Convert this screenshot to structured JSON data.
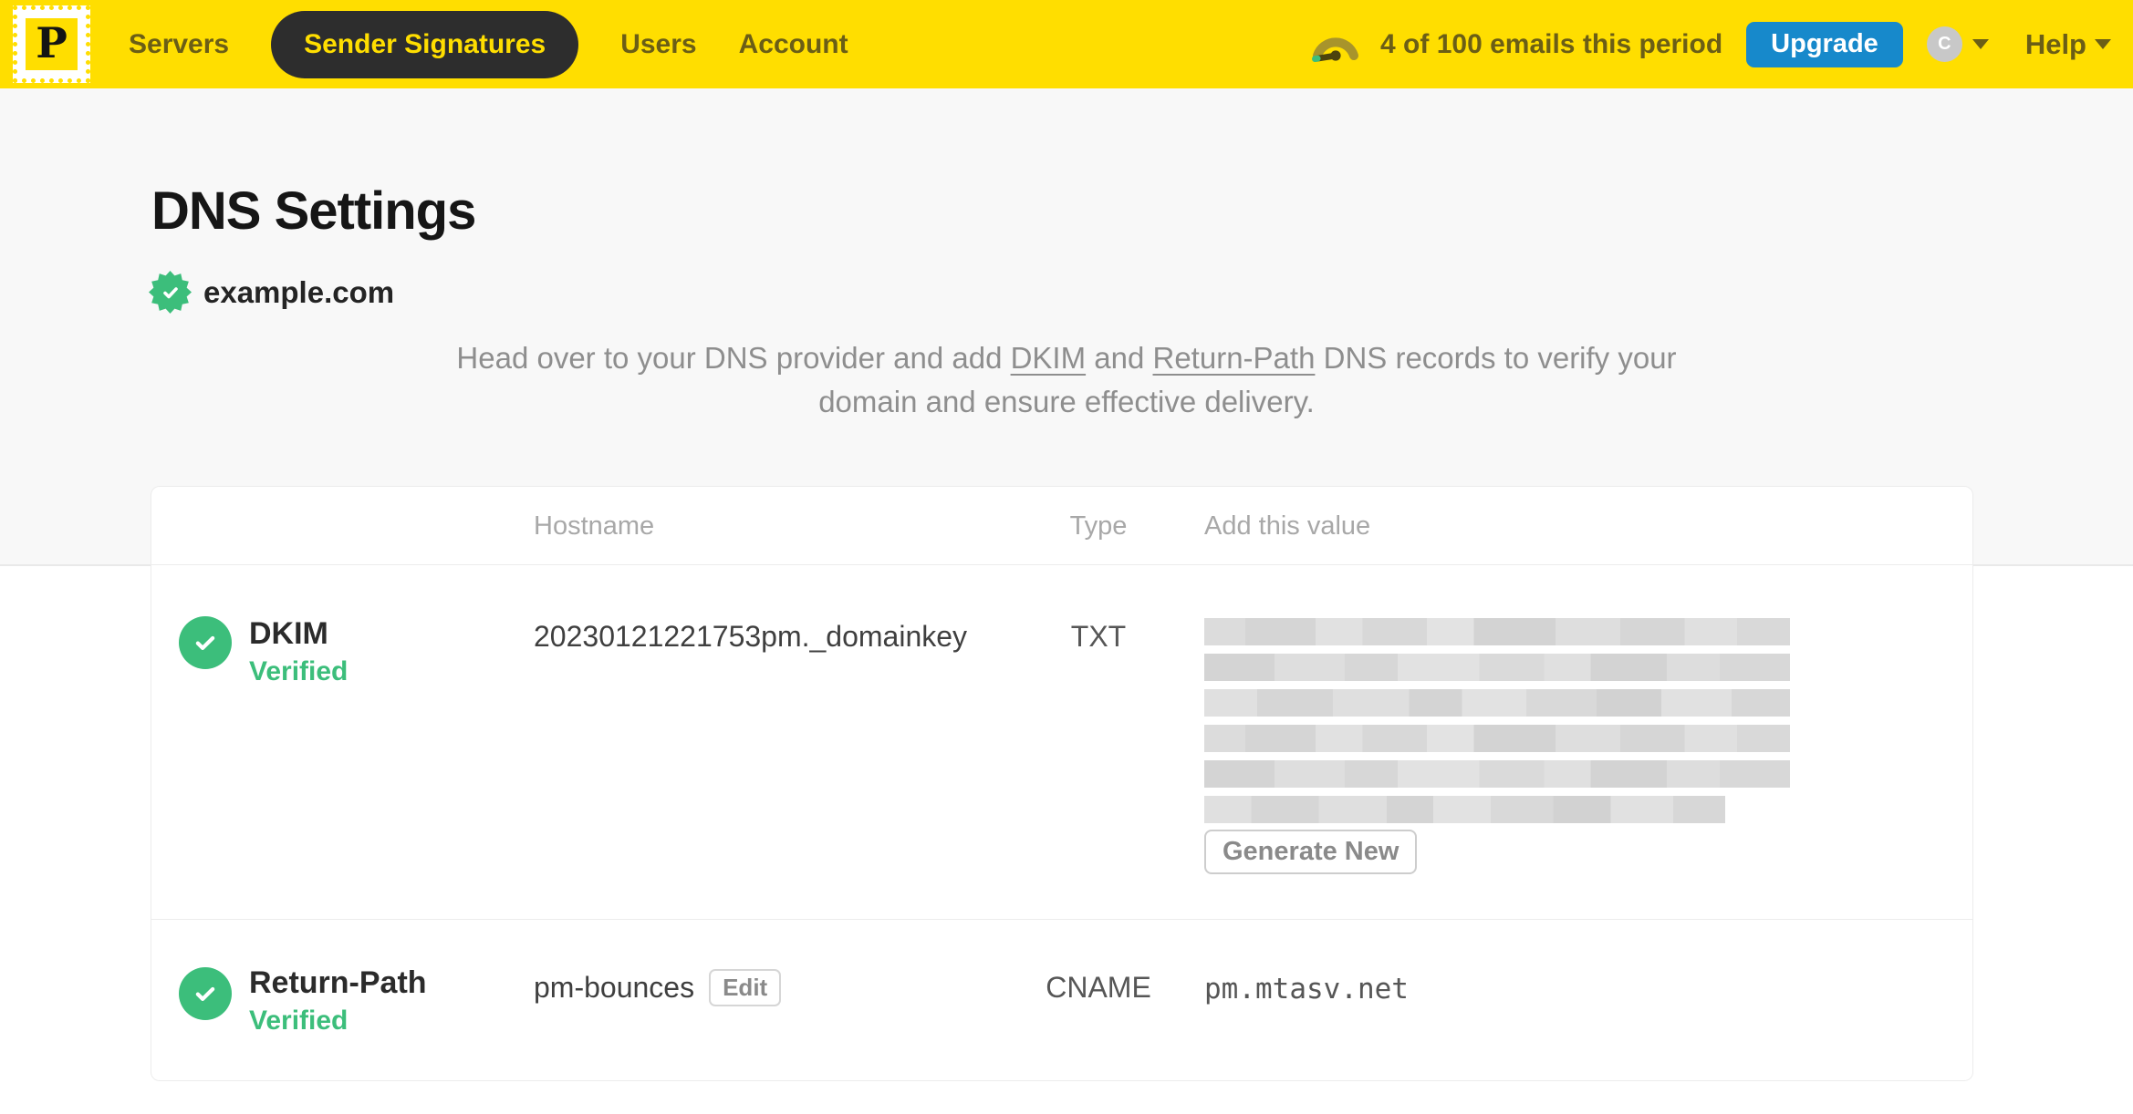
{
  "nav": {
    "logo_letter": "P",
    "items": [
      {
        "label": "Servers",
        "active": false
      },
      {
        "label": "Sender Signatures",
        "active": true
      },
      {
        "label": "Users",
        "active": false
      },
      {
        "label": "Account",
        "active": false
      }
    ],
    "usage_text": "4 of 100 emails this period",
    "upgrade_label": "Upgrade",
    "avatar_initial": "C",
    "help_label": "Help"
  },
  "page": {
    "title": "DNS Settings",
    "domain": "example.com",
    "domain_verified": true,
    "intro": {
      "part1": "Head over to your DNS provider and add ",
      "link1": "DKIM",
      "part2": " and ",
      "link2": "Return-Path",
      "part3": " DNS records to verify your domain and ensure effective delivery."
    }
  },
  "table": {
    "headers": [
      "Hostname",
      "Type",
      "Add this value"
    ],
    "rows": [
      {
        "name": "DKIM",
        "status": "Verified",
        "hostname": "20230121221753pm._domainkey",
        "type": "TXT",
        "value_redacted": true,
        "redacted_line_widths_pct": [
          100,
          100,
          100,
          100,
          100,
          89
        ],
        "action": "Generate New"
      },
      {
        "name": "Return-Path",
        "status": "Verified",
        "hostname": "pm-bounces",
        "hostname_action": "Edit",
        "type": "CNAME",
        "value": "pm.mtasv.net"
      }
    ]
  },
  "colors": {
    "brand_yellow": "#FFDE00",
    "nav_pill_dark": "#2D2D2D",
    "upgrade_blue": "#1789CB",
    "success_green": "#3CBE7B"
  }
}
